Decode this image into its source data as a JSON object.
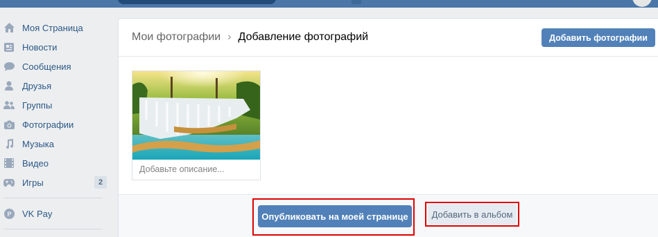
{
  "sidebar": {
    "items": [
      {
        "label": "Моя Страница",
        "icon": "home-icon"
      },
      {
        "label": "Новости",
        "icon": "news-icon"
      },
      {
        "label": "Сообщения",
        "icon": "messages-icon"
      },
      {
        "label": "Друзья",
        "icon": "friend-icon"
      },
      {
        "label": "Группы",
        "icon": "groups-icon"
      },
      {
        "label": "Фотографии",
        "icon": "camera-icon"
      },
      {
        "label": "Музыка",
        "icon": "music-icon"
      },
      {
        "label": "Видео",
        "icon": "video-icon"
      },
      {
        "label": "Игры",
        "icon": "gamepad-icon",
        "count": "2"
      },
      {
        "label": "VK Pay",
        "icon": "vkpay-icon"
      }
    ]
  },
  "header": {
    "breadcrumb_parent": "Мои фотографии",
    "breadcrumb_separator": "›",
    "breadcrumb_current": "Добавление фотографий",
    "add_photos_label": "Добавить фотографии"
  },
  "photo": {
    "description_placeholder": "Добавьте описание..."
  },
  "footer": {
    "publish_label": "Опубликовать на моей странице",
    "add_to_album_label": "Добавить в альбом"
  },
  "colors": {
    "accent": "#5181b8",
    "topbar": "#4a76a8",
    "link": "#2a5885",
    "highlight": "#e00000"
  }
}
